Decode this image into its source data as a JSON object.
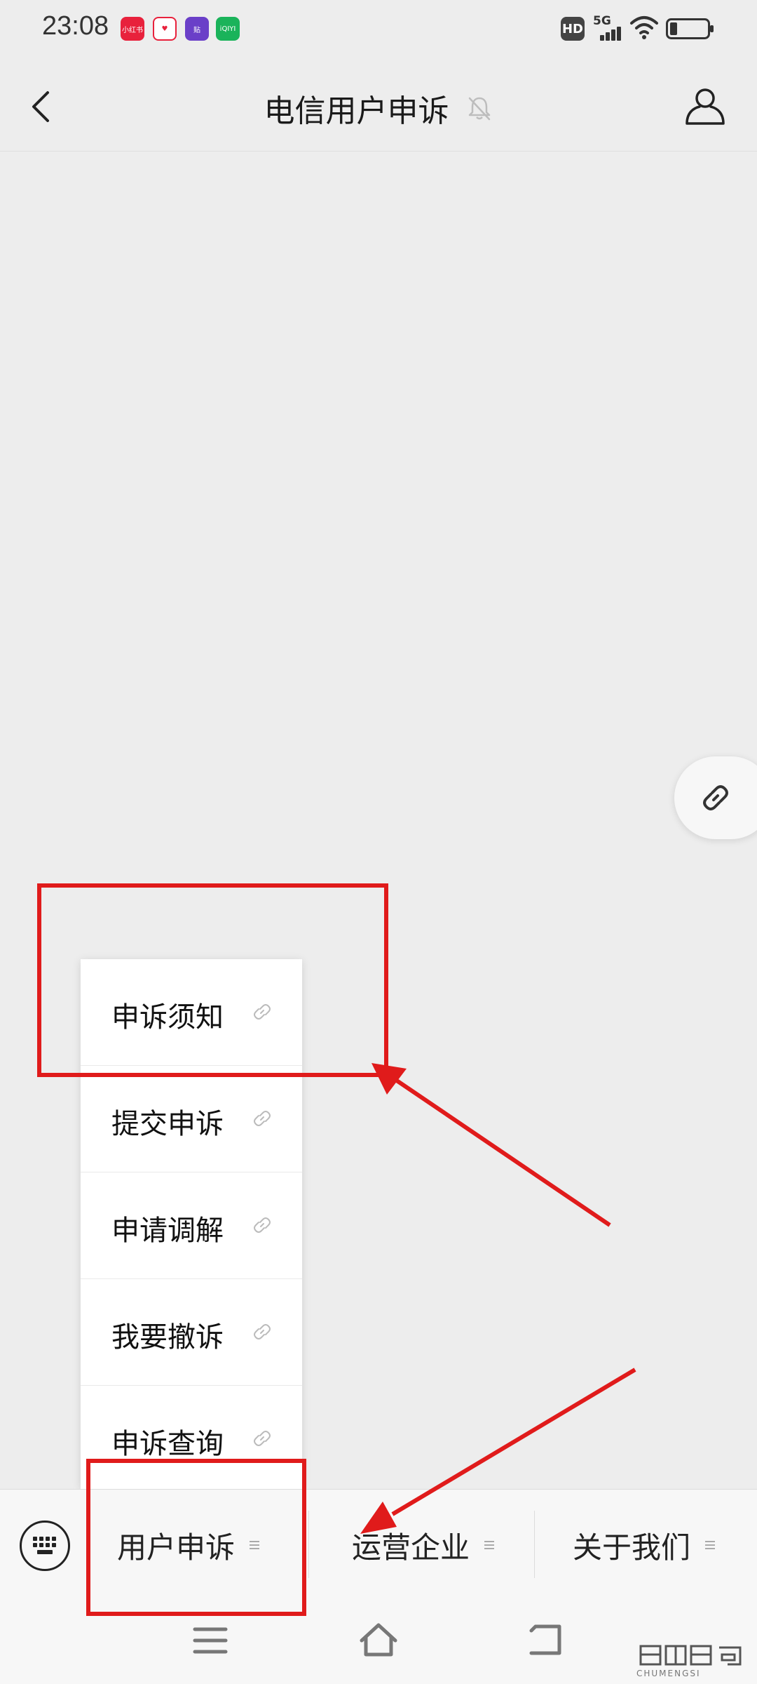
{
  "status_bar": {
    "time": "23:08",
    "notifications": [
      "小红书",
      "♥",
      "贴",
      "iQIYI"
    ],
    "hd": "HD",
    "network": "5G"
  },
  "header": {
    "title": "电信用户申诉"
  },
  "popup_menu": {
    "items": [
      {
        "label": "申诉须知"
      },
      {
        "label": "提交申诉"
      },
      {
        "label": "申请调解"
      },
      {
        "label": "我要撤诉"
      },
      {
        "label": "申诉查询"
      }
    ]
  },
  "bottom_menu": {
    "items": [
      {
        "label": "用户申诉"
      },
      {
        "label": "运营企业"
      },
      {
        "label": "关于我们"
      }
    ]
  },
  "watermark": {
    "label": "CHUMENGSI"
  },
  "colors": {
    "annotation": "#e01b1b",
    "background": "#ededed",
    "menu_bg": "#f7f7f7"
  }
}
